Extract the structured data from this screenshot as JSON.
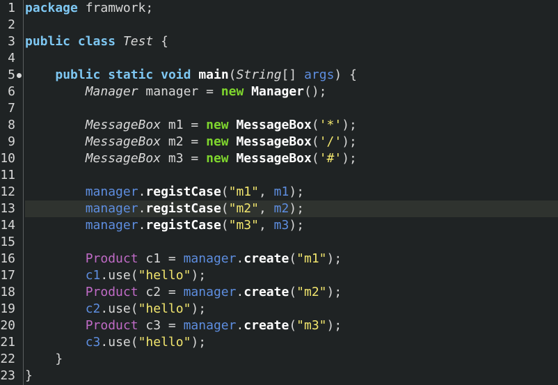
{
  "editor": {
    "colors": {
      "background": "#1f2324",
      "current_line": "#2f332f",
      "keyword": "#7ec7f2",
      "keyword_new": "#7fd62e",
      "string": "#f2e66e",
      "field": "#5e8ee0",
      "class_ref": "#c06bc6"
    },
    "current_line_number": 13,
    "lines": [
      {
        "n": "1",
        "tokens": [
          {
            "t": "package",
            "c": "kw"
          },
          {
            "t": " framwork;",
            "c": "pl"
          }
        ]
      },
      {
        "n": "2",
        "tokens": []
      },
      {
        "n": "3",
        "tokens": [
          {
            "t": "public",
            "c": "kw"
          },
          {
            "t": " ",
            "c": "pl"
          },
          {
            "t": "class",
            "c": "kw"
          },
          {
            "t": " ",
            "c": "pl"
          },
          {
            "t": "Test",
            "c": "ty"
          },
          {
            "t": " {",
            "c": "pl"
          }
        ]
      },
      {
        "n": "4",
        "tokens": []
      },
      {
        "n": "5",
        "marker": true,
        "tokens": [
          {
            "t": "    ",
            "c": "pl"
          },
          {
            "t": "public",
            "c": "kw"
          },
          {
            "t": " ",
            "c": "pl"
          },
          {
            "t": "static",
            "c": "kw"
          },
          {
            "t": " ",
            "c": "pl"
          },
          {
            "t": "void",
            "c": "kw"
          },
          {
            "t": " ",
            "c": "pl"
          },
          {
            "t": "main",
            "c": "fn"
          },
          {
            "t": "(",
            "c": "pl"
          },
          {
            "t": "String",
            "c": "ty"
          },
          {
            "t": "[] ",
            "c": "pl"
          },
          {
            "t": "args",
            "c": "fld"
          },
          {
            "t": ") {",
            "c": "pl"
          }
        ]
      },
      {
        "n": "6",
        "tokens": [
          {
            "t": "        ",
            "c": "pl"
          },
          {
            "t": "Manager",
            "c": "ty"
          },
          {
            "t": " manager = ",
            "c": "pl"
          },
          {
            "t": "new",
            "c": "kw2"
          },
          {
            "t": " ",
            "c": "pl"
          },
          {
            "t": "Manager",
            "c": "fn"
          },
          {
            "t": "();",
            "c": "pl"
          }
        ]
      },
      {
        "n": "7",
        "tokens": []
      },
      {
        "n": "8",
        "tokens": [
          {
            "t": "        ",
            "c": "pl"
          },
          {
            "t": "MessageBox",
            "c": "ty"
          },
          {
            "t": " m1 = ",
            "c": "pl"
          },
          {
            "t": "new",
            "c": "kw2"
          },
          {
            "t": " ",
            "c": "pl"
          },
          {
            "t": "MessageBox",
            "c": "fn"
          },
          {
            "t": "(",
            "c": "pl"
          },
          {
            "t": "'*'",
            "c": "ch"
          },
          {
            "t": ");",
            "c": "pl"
          }
        ]
      },
      {
        "n": "9",
        "tokens": [
          {
            "t": "        ",
            "c": "pl"
          },
          {
            "t": "MessageBox",
            "c": "ty"
          },
          {
            "t": " m2 = ",
            "c": "pl"
          },
          {
            "t": "new",
            "c": "kw2"
          },
          {
            "t": " ",
            "c": "pl"
          },
          {
            "t": "MessageBox",
            "c": "fn"
          },
          {
            "t": "(",
            "c": "pl"
          },
          {
            "t": "'/'",
            "c": "ch"
          },
          {
            "t": ");",
            "c": "pl"
          }
        ]
      },
      {
        "n": "10",
        "tokens": [
          {
            "t": "        ",
            "c": "pl"
          },
          {
            "t": "MessageBox",
            "c": "ty"
          },
          {
            "t": " m3 = ",
            "c": "pl"
          },
          {
            "t": "new",
            "c": "kw2"
          },
          {
            "t": " ",
            "c": "pl"
          },
          {
            "t": "MessageBox",
            "c": "fn"
          },
          {
            "t": "(",
            "c": "pl"
          },
          {
            "t": "'#'",
            "c": "ch"
          },
          {
            "t": ");",
            "c": "pl"
          }
        ]
      },
      {
        "n": "11",
        "tokens": []
      },
      {
        "n": "12",
        "tokens": [
          {
            "t": "        ",
            "c": "pl"
          },
          {
            "t": "manager",
            "c": "var"
          },
          {
            "t": ".",
            "c": "pl"
          },
          {
            "t": "registCase",
            "c": "fn"
          },
          {
            "t": "(",
            "c": "pl"
          },
          {
            "t": "\"m1\"",
            "c": "str"
          },
          {
            "t": ", ",
            "c": "pl"
          },
          {
            "t": "m1",
            "c": "var"
          },
          {
            "t": ");",
            "c": "pl"
          }
        ]
      },
      {
        "n": "13",
        "tokens": [
          {
            "t": "        ",
            "c": "pl"
          },
          {
            "t": "manager",
            "c": "var"
          },
          {
            "t": ".",
            "c": "pl"
          },
          {
            "t": "registCase",
            "c": "fn"
          },
          {
            "t": "(",
            "c": "pl"
          },
          {
            "t": "\"m2\"",
            "c": "str"
          },
          {
            "t": ", ",
            "c": "pl"
          },
          {
            "t": "m2",
            "c": "var"
          },
          {
            "t": ");",
            "c": "pl"
          }
        ]
      },
      {
        "n": "14",
        "tokens": [
          {
            "t": "        ",
            "c": "pl"
          },
          {
            "t": "manager",
            "c": "var"
          },
          {
            "t": ".",
            "c": "pl"
          },
          {
            "t": "registCase",
            "c": "fn"
          },
          {
            "t": "(",
            "c": "pl"
          },
          {
            "t": "\"m3\"",
            "c": "str"
          },
          {
            "t": ", ",
            "c": "pl"
          },
          {
            "t": "m3",
            "c": "var"
          },
          {
            "t": ");",
            "c": "pl"
          }
        ]
      },
      {
        "n": "15",
        "tokens": []
      },
      {
        "n": "16",
        "tokens": [
          {
            "t": "        ",
            "c": "pl"
          },
          {
            "t": "Product",
            "c": "cls"
          },
          {
            "t": " c1 = ",
            "c": "pl"
          },
          {
            "t": "manager",
            "c": "var"
          },
          {
            "t": ".",
            "c": "pl"
          },
          {
            "t": "create",
            "c": "fn"
          },
          {
            "t": "(",
            "c": "pl"
          },
          {
            "t": "\"m1\"",
            "c": "str"
          },
          {
            "t": ");",
            "c": "pl"
          }
        ]
      },
      {
        "n": "17",
        "tokens": [
          {
            "t": "        ",
            "c": "pl"
          },
          {
            "t": "c1",
            "c": "var"
          },
          {
            "t": ".use(",
            "c": "pl"
          },
          {
            "t": "\"hello\"",
            "c": "str"
          },
          {
            "t": ");",
            "c": "pl"
          }
        ]
      },
      {
        "n": "18",
        "tokens": [
          {
            "t": "        ",
            "c": "pl"
          },
          {
            "t": "Product",
            "c": "cls"
          },
          {
            "t": " c2 = ",
            "c": "pl"
          },
          {
            "t": "manager",
            "c": "var"
          },
          {
            "t": ".",
            "c": "pl"
          },
          {
            "t": "create",
            "c": "fn"
          },
          {
            "t": "(",
            "c": "pl"
          },
          {
            "t": "\"m2\"",
            "c": "str"
          },
          {
            "t": ");",
            "c": "pl"
          }
        ]
      },
      {
        "n": "19",
        "tokens": [
          {
            "t": "        ",
            "c": "pl"
          },
          {
            "t": "c2",
            "c": "var"
          },
          {
            "t": ".use(",
            "c": "pl"
          },
          {
            "t": "\"hello\"",
            "c": "str"
          },
          {
            "t": ");",
            "c": "pl"
          }
        ]
      },
      {
        "n": "20",
        "tokens": [
          {
            "t": "        ",
            "c": "pl"
          },
          {
            "t": "Product",
            "c": "cls"
          },
          {
            "t": " c3 = ",
            "c": "pl"
          },
          {
            "t": "manager",
            "c": "var"
          },
          {
            "t": ".",
            "c": "pl"
          },
          {
            "t": "create",
            "c": "fn"
          },
          {
            "t": "(",
            "c": "pl"
          },
          {
            "t": "\"m3\"",
            "c": "str"
          },
          {
            "t": ");",
            "c": "pl"
          }
        ]
      },
      {
        "n": "21",
        "tokens": [
          {
            "t": "        ",
            "c": "pl"
          },
          {
            "t": "c3",
            "c": "var"
          },
          {
            "t": ".use(",
            "c": "pl"
          },
          {
            "t": "\"hello\"",
            "c": "str"
          },
          {
            "t": ");",
            "c": "pl"
          }
        ]
      },
      {
        "n": "22",
        "tokens": [
          {
            "t": "    }",
            "c": "pl"
          }
        ]
      },
      {
        "n": "23",
        "tokens": [
          {
            "t": "}",
            "c": "pl"
          }
        ]
      }
    ]
  }
}
